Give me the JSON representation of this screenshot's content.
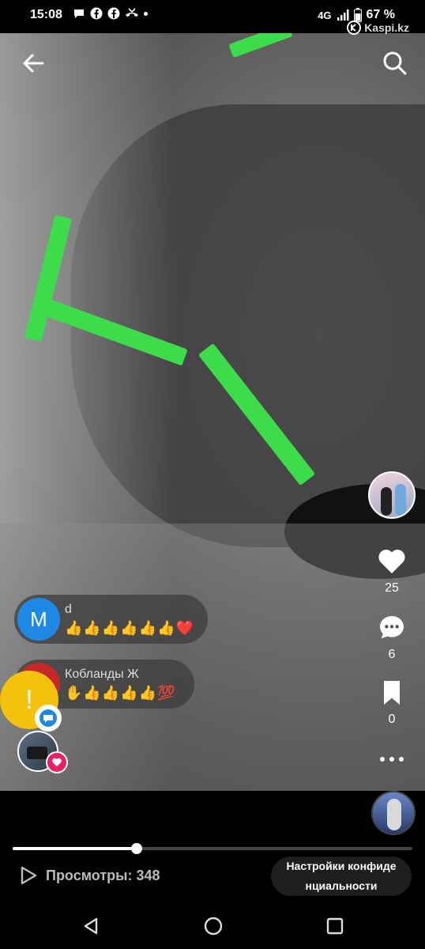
{
  "status_bar": {
    "time": "15:08",
    "network": "4G",
    "battery": "67 %",
    "icons": [
      "chat-bubble-icon",
      "facebook-icon",
      "facebook-icon",
      "missed-call-icon",
      "dot-icon",
      "signal-icon",
      "battery-icon"
    ]
  },
  "watermark": "Kaspi.kz",
  "top_bar": {
    "back_icon": "arrow-left-icon",
    "search_icon": "search-icon"
  },
  "comments": [
    {
      "avatar_letter": "M",
      "avatar_color": "#1e88e5",
      "name": "d",
      "text": "👍👍👍👍👍👍❤️"
    },
    {
      "avatar_letter": "",
      "avatar_color": "#c62828",
      "name": "Кобланды Ж",
      "text": "✋👍👍👍👍💯"
    }
  ],
  "alert": {
    "symbol": "!",
    "color": "#f4c20d"
  },
  "side_actions": {
    "likes": "25",
    "comments": "6",
    "saves": "0",
    "more_icon": "more-horizontal-icon"
  },
  "views": {
    "label": "Просмотры: 348"
  },
  "privacy_button": {
    "line1": "Настройки конфиде",
    "line2": "нциальности"
  },
  "progress": {
    "value": 0.31
  },
  "colors": {
    "accent": "#3ddc4a",
    "heart": "#e91e63",
    "badge_blue": "#1e88e5"
  }
}
